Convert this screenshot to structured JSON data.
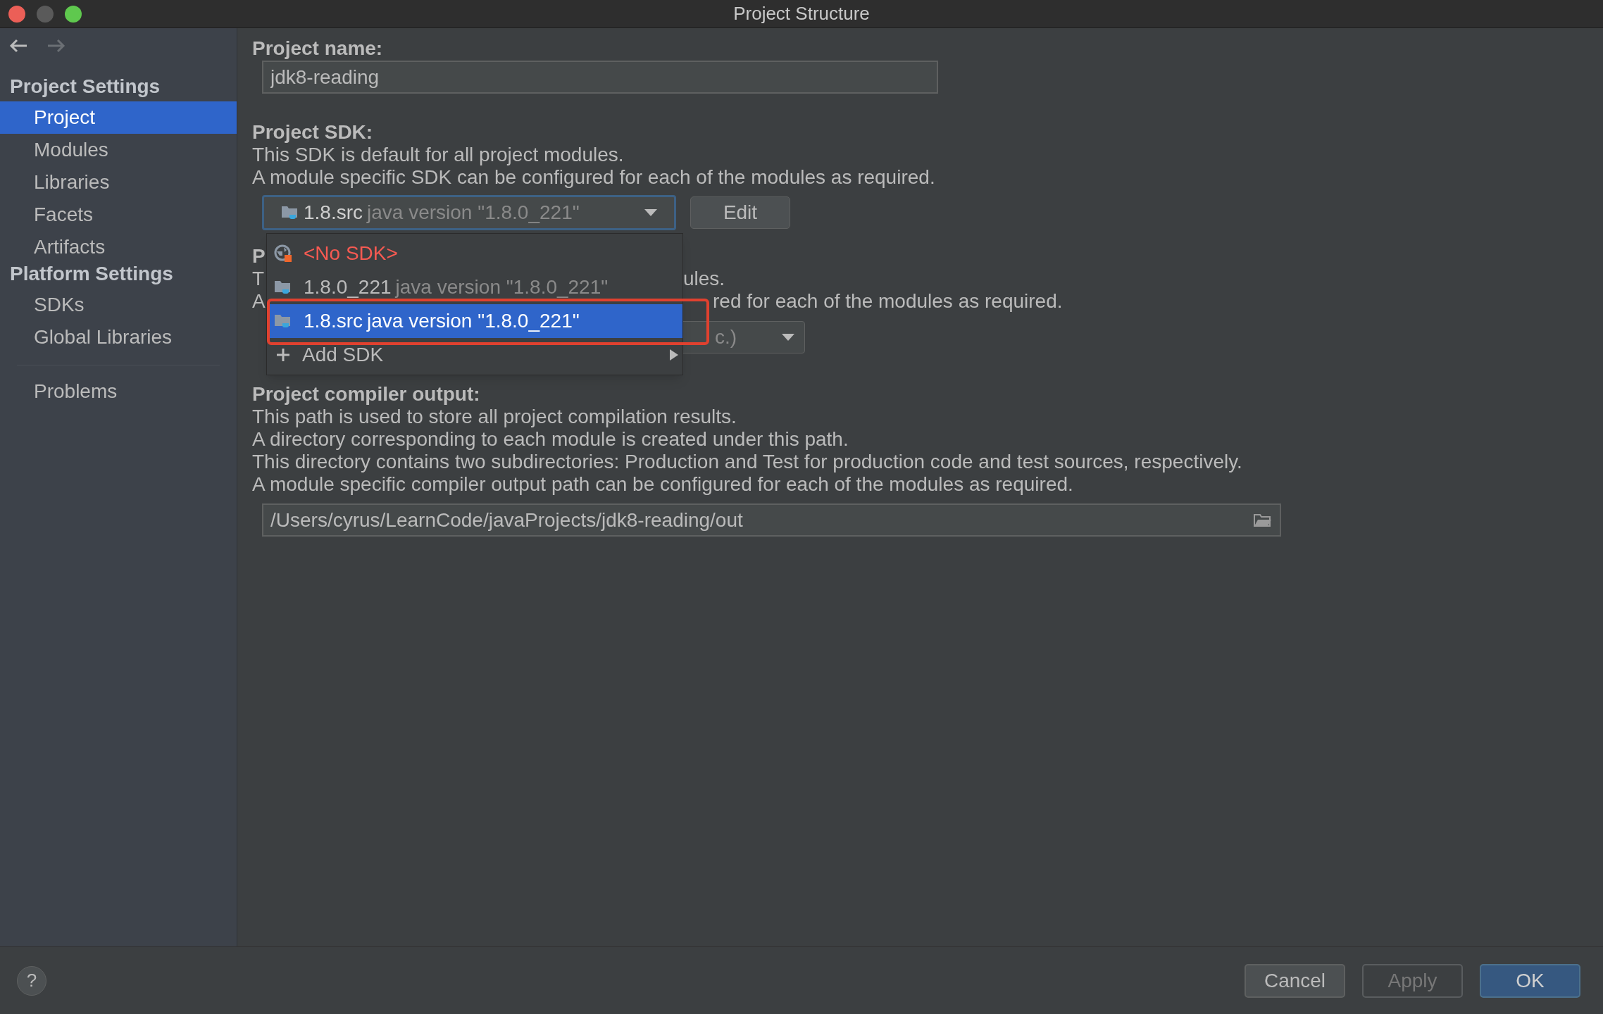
{
  "window": {
    "title": "Project Structure"
  },
  "sidebar": {
    "sections": [
      {
        "title": "Project Settings",
        "items": [
          {
            "label": "Project",
            "selected": true
          },
          {
            "label": "Modules",
            "selected": false
          },
          {
            "label": "Libraries",
            "selected": false
          },
          {
            "label": "Facets",
            "selected": false
          },
          {
            "label": "Artifacts",
            "selected": false
          }
        ]
      },
      {
        "title": "Platform Settings",
        "items": [
          {
            "label": "SDKs",
            "selected": false
          },
          {
            "label": "Global Libraries",
            "selected": false
          }
        ]
      }
    ],
    "bottom_items": [
      {
        "label": "Problems",
        "selected": false
      }
    ]
  },
  "project_name": {
    "label": "Project name:",
    "value": "jdk8-reading"
  },
  "project_sdk": {
    "label": "Project SDK:",
    "description": [
      "This SDK is default for all project modules.",
      "A module specific SDK can be configured for each of the modules as required."
    ],
    "combo": {
      "name": "1.8.src",
      "detail": "java version \"1.8.0_221\""
    },
    "edit_button": "Edit",
    "popup": [
      {
        "kind": "none",
        "label": "<No SDK>",
        "selected": false,
        "annotated": false
      },
      {
        "kind": "sdk",
        "name": "1.8.0_221",
        "detail": "java version \"1.8.0_221\"",
        "selected": false,
        "annotated": false
      },
      {
        "kind": "sdk",
        "name": "1.8.src",
        "detail": "java version \"1.8.0_221\"",
        "selected": true,
        "annotated": true
      },
      {
        "kind": "add",
        "label": "Add SDK",
        "selected": false,
        "annotated": false
      }
    ]
  },
  "language_level_partial": {
    "heading": "P",
    "line_1_start": "T",
    "line_1_end": "ules.",
    "line_2_start": "A",
    "line_2_end": "red for each of the modules as required.",
    "combo_text": "c.)"
  },
  "compiler_output": {
    "label": "Project compiler output:",
    "description": [
      "This path is used to store all project compilation results.",
      "A directory corresponding to each module is created under this path.",
      "This directory contains two subdirectories: Production and Test for production code and test sources, respectively.",
      "A module specific compiler output path can be configured for each of the modules as required."
    ],
    "path": "/Users/cyrus/LearnCode/javaProjects/jdk8-reading/out"
  },
  "help_button": {
    "label": "?"
  },
  "buttons": [
    {
      "label": "Cancel",
      "kind": "default",
      "disabled": false
    },
    {
      "label": "Apply",
      "kind": "default",
      "disabled": true
    },
    {
      "label": "OK",
      "kind": "primary",
      "disabled": false
    }
  ]
}
